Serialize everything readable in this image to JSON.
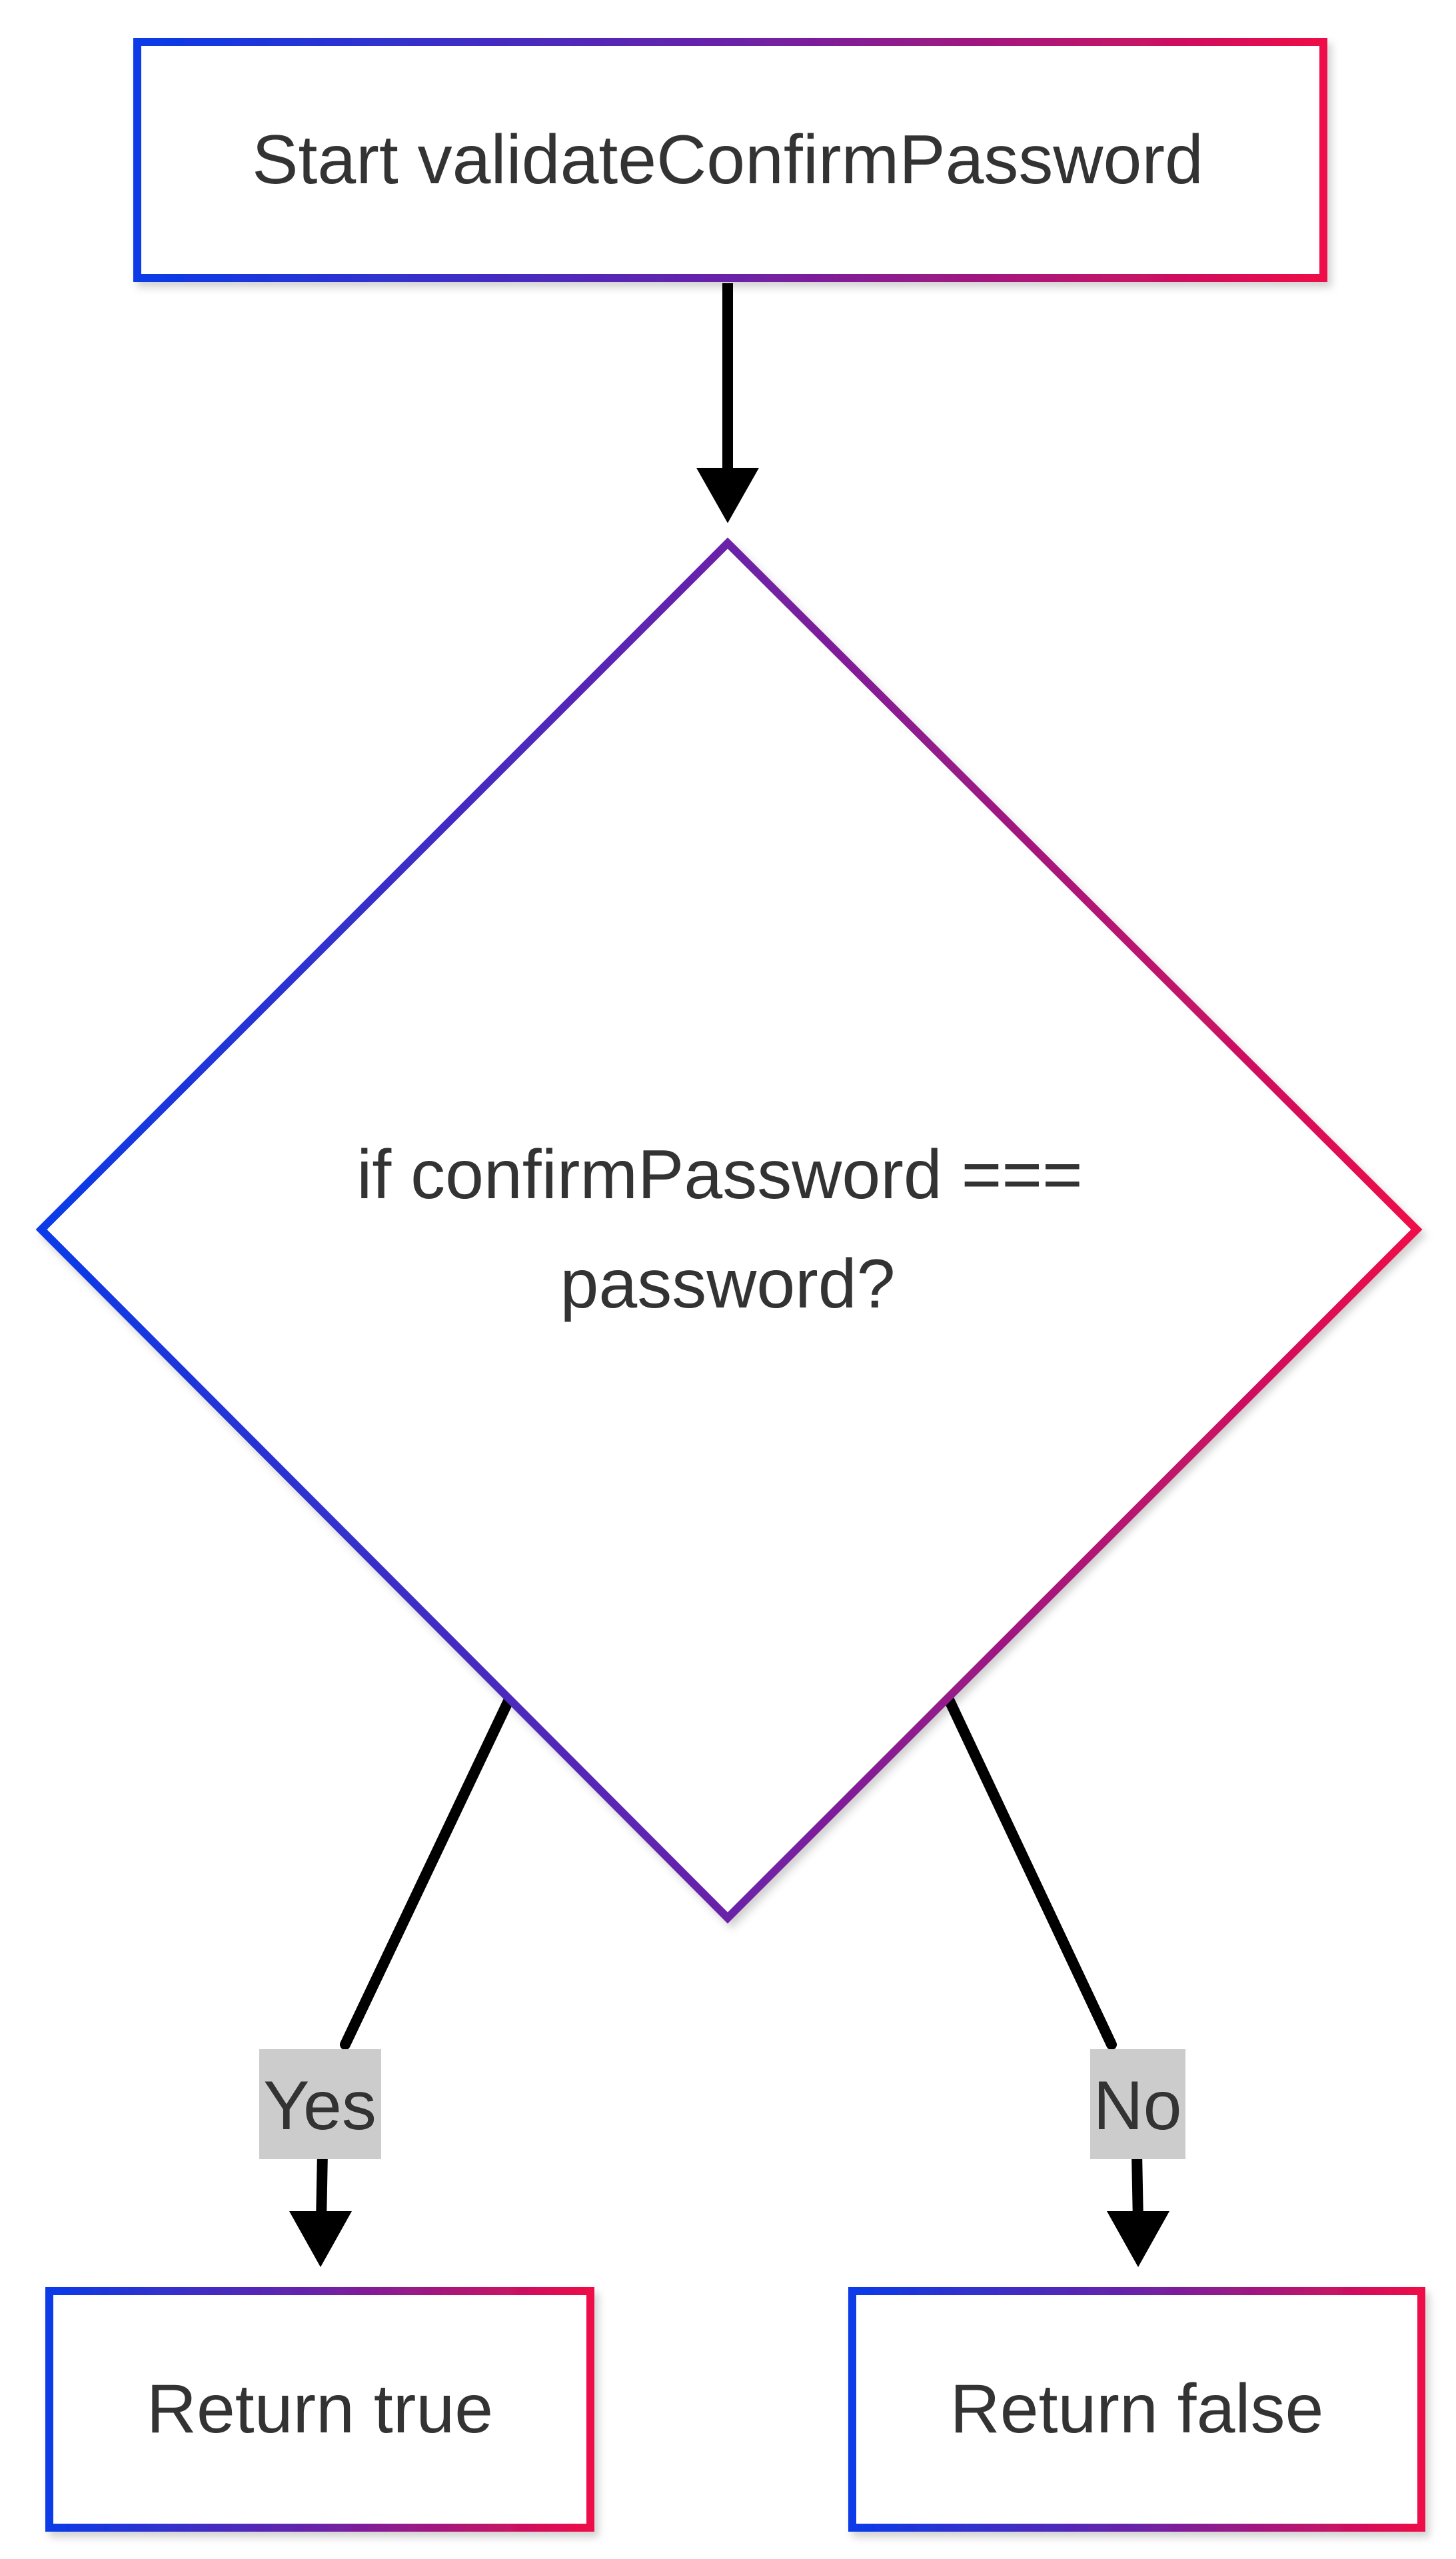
{
  "diagram": {
    "nodes": {
      "start": {
        "label": "Start validateConfirmPassword"
      },
      "decision": {
        "label_line1": "if confirmPassword ===",
        "label_line2": "password?"
      },
      "return_true": {
        "label": "Return true"
      },
      "return_false": {
        "label": "Return false"
      }
    },
    "edges": {
      "start_to_decision": {
        "from": "start",
        "to": "decision"
      },
      "yes": {
        "from": "decision",
        "to": "return_true",
        "label": "Yes"
      },
      "no": {
        "from": "decision",
        "to": "return_false",
        "label": "No"
      }
    },
    "colors": {
      "border_gradient_start": "#0a3be8",
      "border_gradient_mid": "#6a22a8",
      "border_gradient_end": "#ee0b48",
      "edge": "#000000",
      "edge_label_bg": "#cccccc",
      "text": "#333333",
      "background": "#ffffff"
    }
  }
}
